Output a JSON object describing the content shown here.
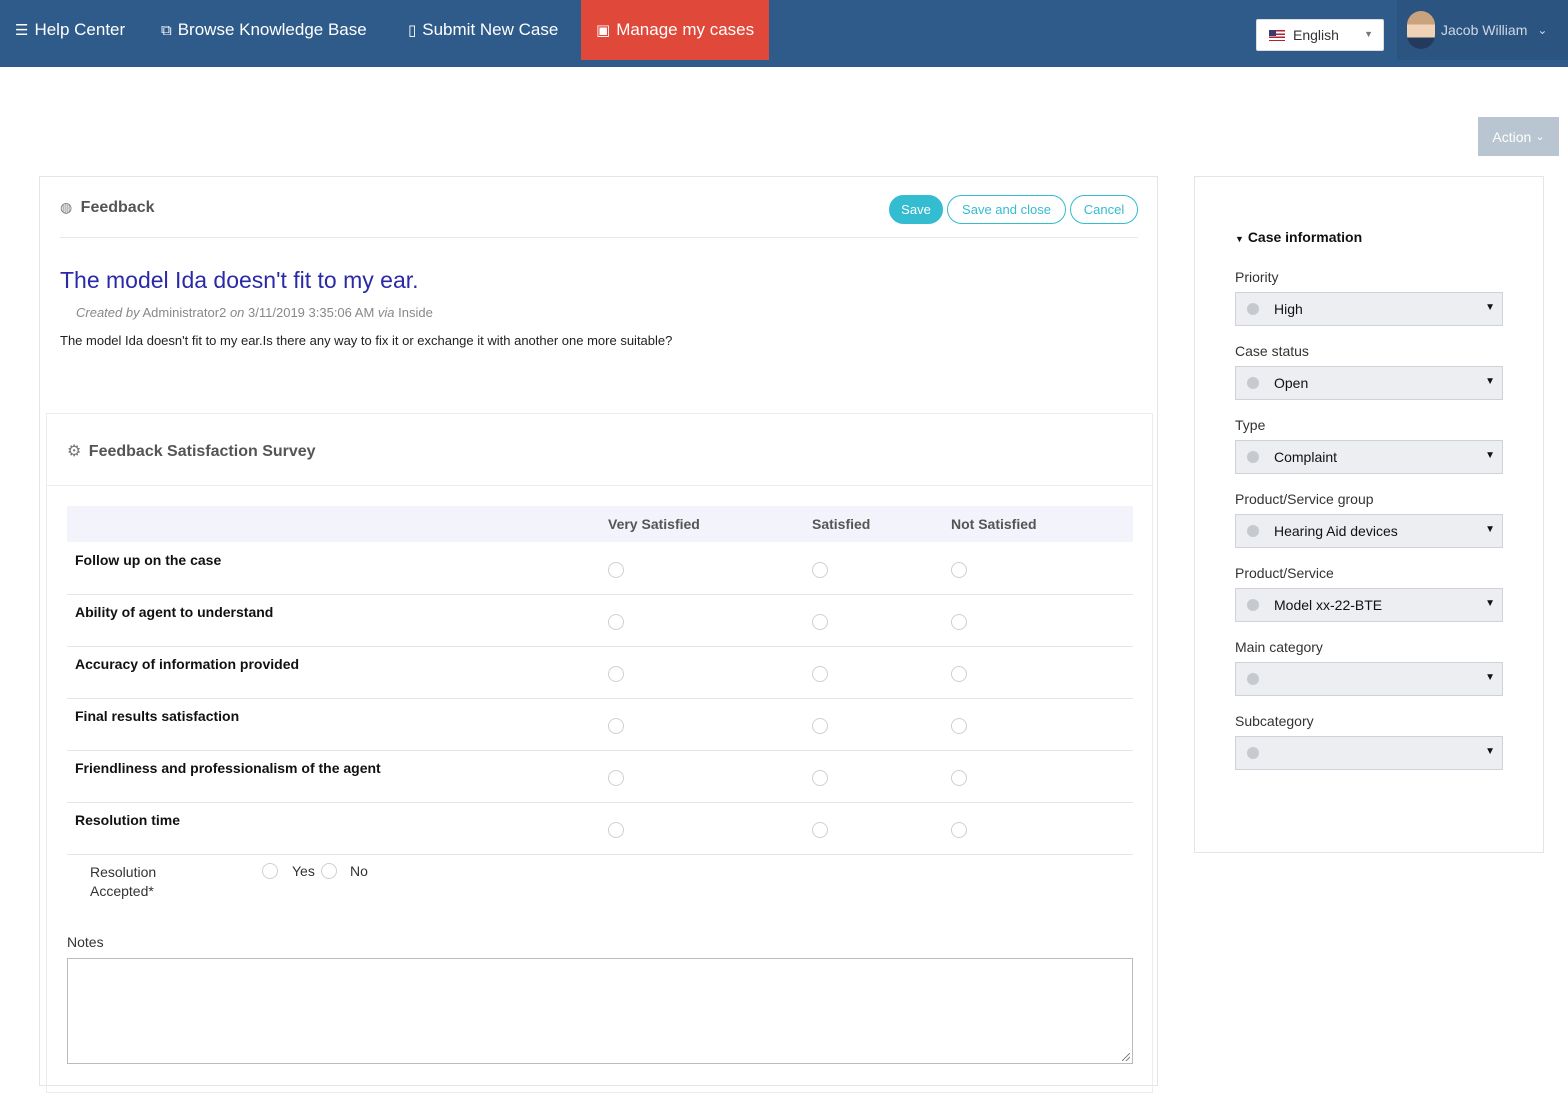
{
  "nav": {
    "items": [
      {
        "icon": "list-icon",
        "glyph": "☰",
        "label": "Help Center"
      },
      {
        "icon": "book-icon",
        "glyph": "⧉",
        "label": "Browse Knowledge Base"
      },
      {
        "icon": "clipboard-icon",
        "glyph": "▯",
        "label": "Submit New Case"
      },
      {
        "icon": "image-icon",
        "glyph": "▣",
        "label": "Manage my cases"
      }
    ],
    "language": "English",
    "user_name": "Jacob William"
  },
  "action_label": "Action",
  "feedback": {
    "section_title": "Feedback",
    "save_label": "Save",
    "save_close_label": "Save and close",
    "cancel_label": "Cancel",
    "case_title": "The model Ida doesn't fit to my ear.",
    "created_by_prefix": "Created by",
    "created_by": "Administrator2",
    "on_prefix": "on",
    "created_on": "3/11/2019 3:35:06 AM",
    "via_prefix": "via",
    "via": "Inside",
    "description": "The model Ida doesn't fit to my ear.Is there any way to fix it or exchange it with another one more suitable?"
  },
  "survey": {
    "title": "Feedback Satisfaction Survey",
    "columns": [
      "Very Satisfied",
      "Satisfied",
      "Not Satisfied"
    ],
    "rows": [
      "Follow up on the case",
      "Ability of agent to understand",
      "Accuracy of information provided",
      "Final results satisfaction",
      "Friendliness and professionalism of the agent",
      "Resolution time"
    ],
    "resolution_label_1": "Resolution",
    "resolution_label_2": "Accepted*",
    "resolution_yes": "Yes",
    "resolution_no": "No",
    "notes_label": "Notes"
  },
  "case_info": {
    "title": "Case information",
    "fields": [
      {
        "label": "Priority",
        "value": "High"
      },
      {
        "label": "Case status",
        "value": "Open"
      },
      {
        "label": "Type",
        "value": "Complaint"
      },
      {
        "label": "Product/Service group",
        "value": "Hearing Aid devices"
      },
      {
        "label": "Product/Service",
        "value": "Model xx-22-BTE"
      },
      {
        "label": "Main category",
        "value": ""
      },
      {
        "label": "Subcategory",
        "value": ""
      }
    ]
  },
  "colors": {
    "nav_bg": "#2e5b8a",
    "nav_active": "#e0483a",
    "accent": "#34bcd0",
    "title_blue": "#2a2aa8"
  }
}
